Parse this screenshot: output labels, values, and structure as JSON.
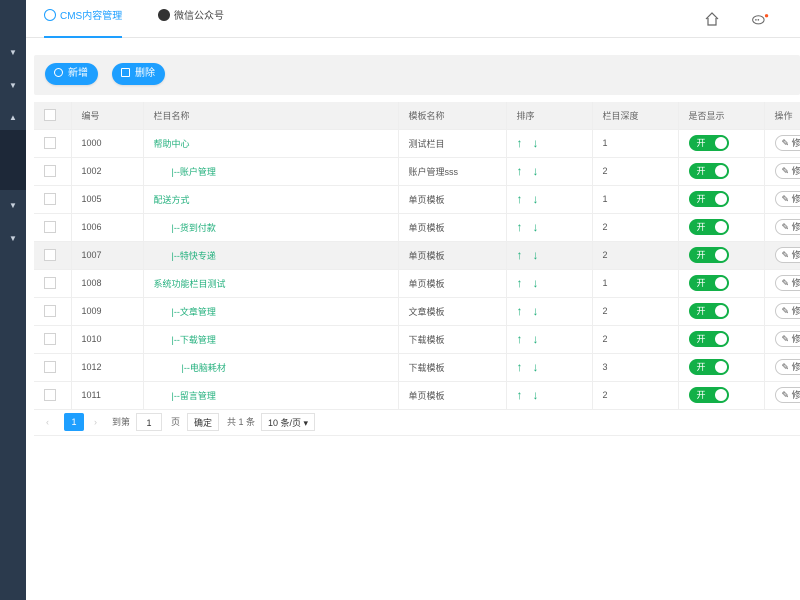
{
  "tabs": [
    {
      "label": "CMS内容管理",
      "icon": "globe-icon"
    },
    {
      "label": "微信公众号",
      "icon": "wechat-icon"
    }
  ],
  "toolbar": {
    "add_label": "新增",
    "delete_label": "删除"
  },
  "table": {
    "headers": [
      "编号",
      "栏目名称",
      "模板名称",
      "排序",
      "栏目深度",
      "是否显示",
      "操作"
    ],
    "rows": [
      {
        "id": "1000",
        "name": "帮助中心",
        "template": "测试栏目",
        "depth": "1"
      },
      {
        "id": "1002",
        "name": "|--账户管理",
        "template": "账户管理sss",
        "depth": "2"
      },
      {
        "id": "1005",
        "name": "配送方式",
        "template": "单页模板",
        "depth": "1"
      },
      {
        "id": "1006",
        "name": "|--货到付款",
        "template": "单页模板",
        "depth": "2"
      },
      {
        "id": "1007",
        "name": "|--特快专递",
        "template": "单页模板",
        "depth": "2"
      },
      {
        "id": "1008",
        "name": "系统功能栏目测试",
        "template": "单页模板",
        "depth": "1"
      },
      {
        "id": "1009",
        "name": "|--文章管理",
        "template": "文章模板",
        "depth": "2"
      },
      {
        "id": "1010",
        "name": "|--下载管理",
        "template": "下载模板",
        "depth": "2"
      },
      {
        "id": "1012",
        "name": "|--电脑耗材",
        "template": "下载模板",
        "depth": "3"
      },
      {
        "id": "1011",
        "name": "|--留言管理",
        "template": "单页模板",
        "depth": "2"
      }
    ],
    "switch_label": "开",
    "edit_label": "修"
  },
  "pager": {
    "current": "1",
    "goto_label": "到第",
    "page_input": "1",
    "page_unit": "页",
    "confirm": "确定",
    "total": "共 1 条",
    "per_page": "10 条/页"
  },
  "colors": {
    "accent": "#1e9fff",
    "link": "#23b07d",
    "switch_on": "#12b048",
    "sidebar": "#2b3a4d"
  }
}
